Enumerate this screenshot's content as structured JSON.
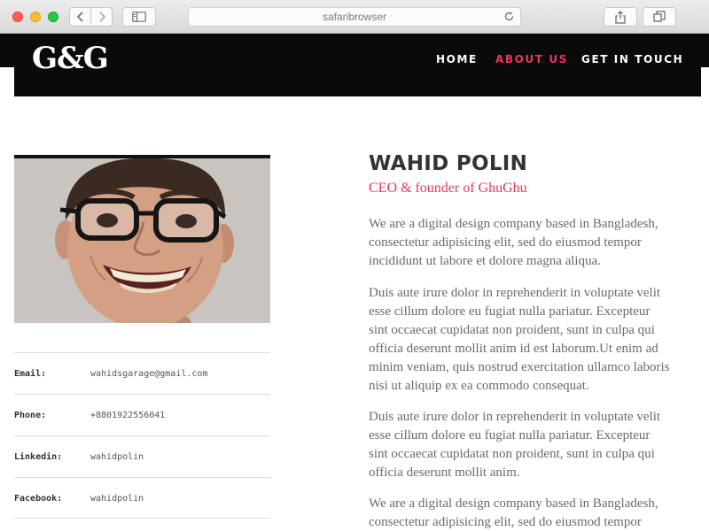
{
  "browser": {
    "url": "safaribrowser"
  },
  "site": {
    "logo": "G&G",
    "menu": [
      {
        "label": "HOME",
        "color": "#ffffff"
      },
      {
        "label": "ABOUT US",
        "color": "#e8365d"
      },
      {
        "label": "GET IN TOUCH",
        "color": "#ffffff"
      }
    ]
  },
  "profile": {
    "name": "WAHID POLIN",
    "role": "CEO & founder of GhuGhu",
    "contact": [
      {
        "label": "Email:",
        "value": "wahidsgarage@gmail.com"
      },
      {
        "label": "Phone:",
        "value": "+8801922556041"
      },
      {
        "label": "Linkedin:",
        "value": "wahidpolin"
      },
      {
        "label": "Facebook:",
        "value": "wahidpolin"
      }
    ],
    "bio": [
      [
        "We are a digital design company based in Bangladesh,",
        "consectetur adipisicing elit, sed do eiusmod tempor",
        "incididunt ut labore et dolore magna aliqua."
      ],
      [
        "Duis aute irure dolor in reprehenderit in voluptate velit",
        "esse cillum dolore eu fugiat nulla pariatur. Excepteur",
        "sint occaecat cupidatat non proident, sunt in culpa qui",
        "officia deserunt mollit anim id est laborum.Ut enim ad",
        "minim veniam, quis nostrud exercitation ullamco laboris",
        "nisi ut aliquip ex ea commodo consequat."
      ],
      [
        "Duis aute irure dolor in reprehenderit in voluptate velit",
        "esse cillum dolore eu fugiat nulla pariatur. Excepteur",
        "sint occaecat cupidatat non proident, sunt in culpa qui",
        "officia deserunt mollit anim."
      ],
      [
        "We are a digital design company based in Bangladesh,",
        "consectetur adipisicing elit, sed do eiusmod tempor"
      ]
    ]
  },
  "colors": {
    "accent": "#e8365d",
    "header_bg": "#0a0a0a"
  }
}
